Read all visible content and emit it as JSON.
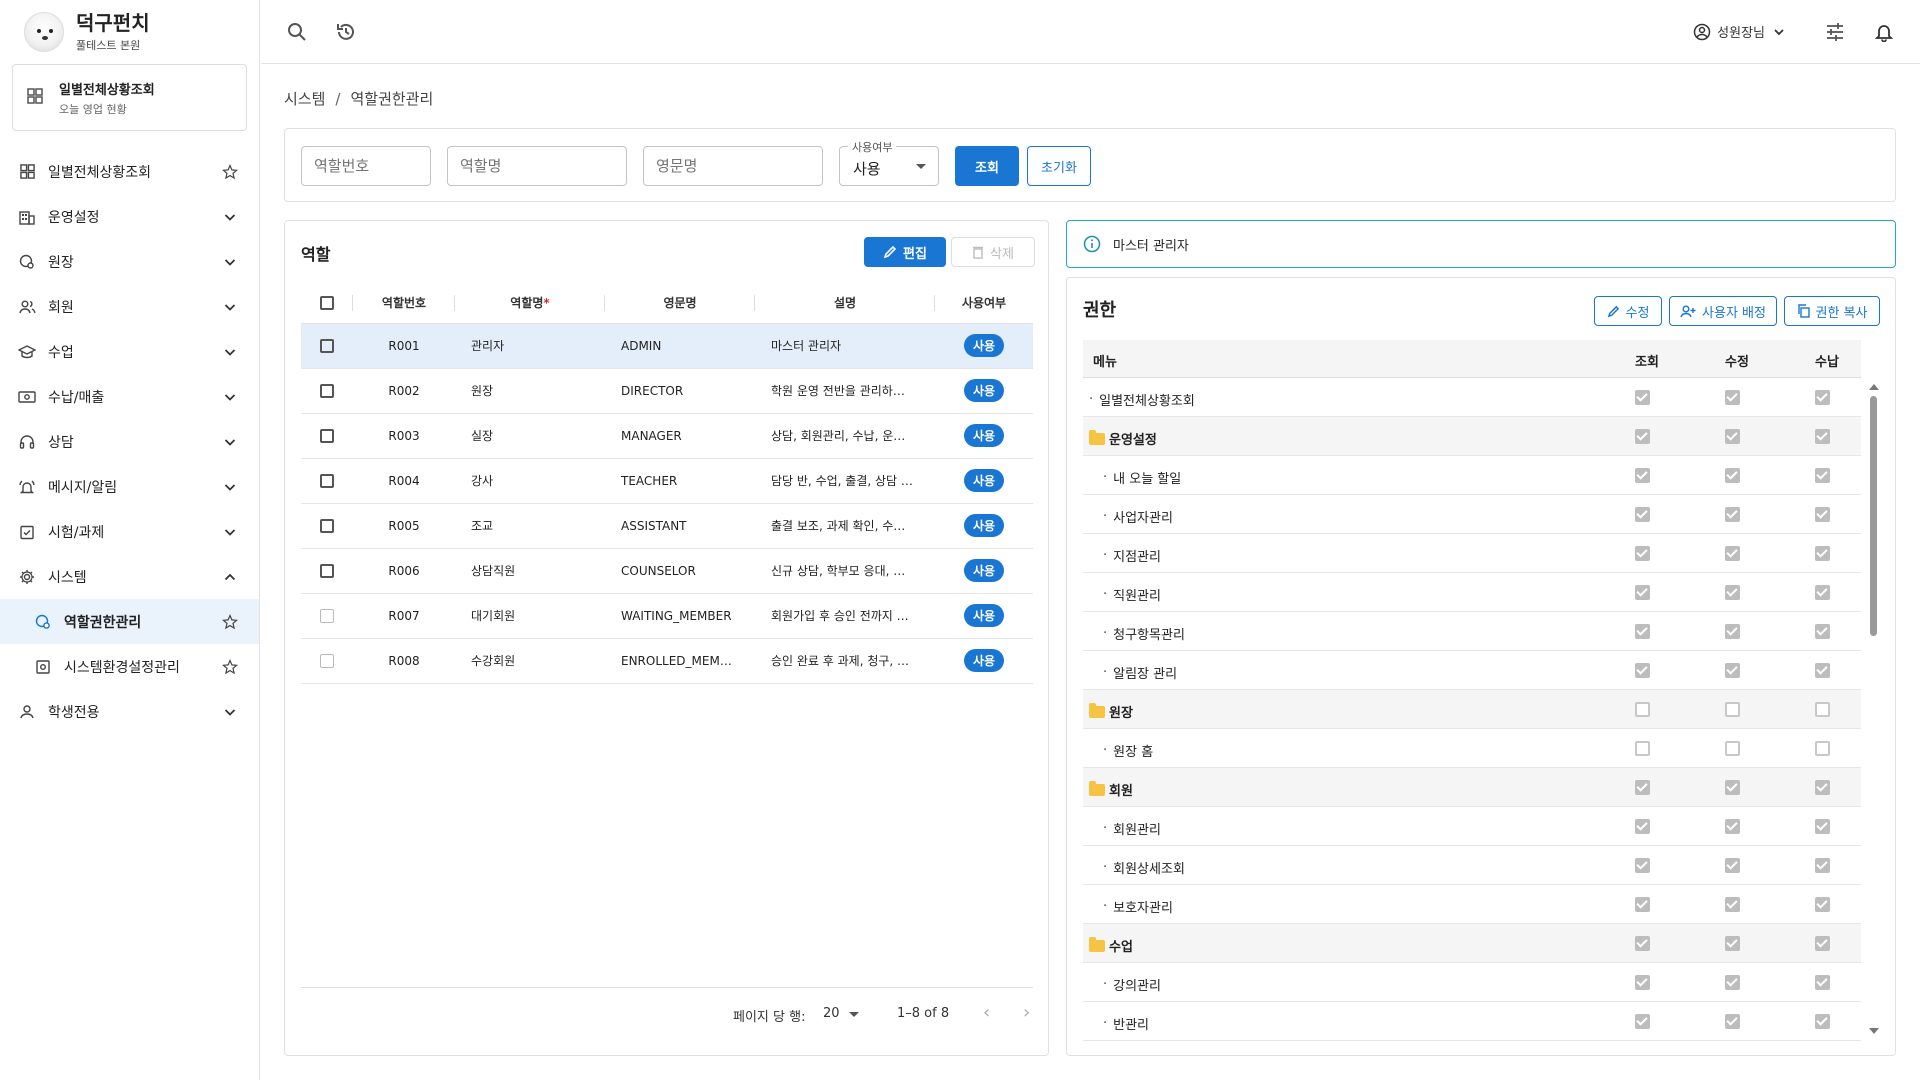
{
  "brand": {
    "title": "덕구펀치",
    "subtitle": "풀테스트 본원"
  },
  "quick_card": {
    "title": "일별전체상황조회",
    "subtitle": "오늘 영업 현황"
  },
  "sidebar": {
    "items": [
      {
        "label": "일별전체상황조회",
        "icon": "dashboard-icon",
        "right": "star-icon"
      },
      {
        "label": "운영설정",
        "icon": "building-icon",
        "right": "chevron-down-icon"
      },
      {
        "label": "원장",
        "icon": "person-gear-icon",
        "right": "chevron-down-icon"
      },
      {
        "label": "회원",
        "icon": "users-icon",
        "right": "chevron-down-icon"
      },
      {
        "label": "수업",
        "icon": "school-icon",
        "right": "chevron-down-icon"
      },
      {
        "label": "수납/매출",
        "icon": "payment-icon",
        "right": "chevron-down-icon"
      },
      {
        "label": "상담",
        "icon": "headset-icon",
        "right": "chevron-down-icon"
      },
      {
        "label": "메시지/알림",
        "icon": "bell-ring-icon",
        "right": "chevron-down-icon"
      },
      {
        "label": "시험/과제",
        "icon": "assignment-icon",
        "right": "chevron-down-icon"
      },
      {
        "label": "시스템",
        "icon": "gear-icon",
        "right": "chevron-up-icon"
      },
      {
        "label": "역할권한관리",
        "icon": "role-icon",
        "right": "star-icon",
        "sub": true,
        "active": true
      },
      {
        "label": "시스템환경설정관리",
        "icon": "settings-box-icon",
        "right": "star-icon",
        "sub": true
      },
      {
        "label": "학생전용",
        "icon": "person-icon",
        "right": "chevron-down-icon"
      }
    ]
  },
  "header": {
    "user": "성원장님"
  },
  "breadcrumb": {
    "root": "시스템",
    "sep": "/",
    "current": "역할권한관리"
  },
  "filter": {
    "role_no_placeholder": "역할번호",
    "role_name_placeholder": "역할명",
    "eng_name_placeholder": "영문명",
    "use_legend": "사용여부",
    "use_value": "사용",
    "search_label": "조회",
    "reset_label": "초기화"
  },
  "roles": {
    "title": "역할",
    "edit_label": "편집",
    "delete_label": "삭제",
    "columns": {
      "no": "역할번호",
      "name": "역할명",
      "name_req": "*",
      "eng": "영문명",
      "desc": "설명",
      "use": "사용여부"
    },
    "rows": [
      {
        "no": "R001",
        "name": "관리자",
        "eng": "ADMIN",
        "desc": "마스터 관리자",
        "use": "사용"
      },
      {
        "no": "R002",
        "name": "원장",
        "eng": "DIRECTOR",
        "desc": "학원 운영 전반을 관리하…",
        "use": "사용"
      },
      {
        "no": "R003",
        "name": "실장",
        "eng": "MANAGER",
        "desc": "상담, 회원관리, 수납, 운…",
        "use": "사용"
      },
      {
        "no": "R004",
        "name": "강사",
        "eng": "TEACHER",
        "desc": "담당 반, 수업, 출결, 상담 …",
        "use": "사용"
      },
      {
        "no": "R005",
        "name": "조교",
        "eng": "ASSISTANT",
        "desc": "출결 보조, 과제 확인, 수…",
        "use": "사용"
      },
      {
        "no": "R006",
        "name": "상담직원",
        "eng": "COUNSELOR",
        "desc": "신규 상담, 학부모 응대, …",
        "use": "사용"
      },
      {
        "no": "R007",
        "name": "대기회원",
        "eng": "WAITING_MEMBER",
        "desc": "회원가입 후 승인 전까지 …",
        "use": "사용"
      },
      {
        "no": "R008",
        "name": "수강회원",
        "eng": "ENROLLED_MEM…",
        "desc": "승인 완료 후 과제, 청구, …",
        "use": "사용"
      }
    ],
    "pager": {
      "rows_per_page_label": "페이지 당 행:",
      "rows_per_page": "20",
      "range": "1–8 of 8"
    }
  },
  "info": {
    "text": "마스터 관리자"
  },
  "perm": {
    "title": "권한",
    "edit_label": "수정",
    "assign_label": "사용자 배정",
    "copy_label": "권한 복사",
    "columns": {
      "menu": "메뉴",
      "view": "조회",
      "edit": "수정",
      "pay": "수납"
    },
    "rows": [
      {
        "name": "일별전체상황조회",
        "type": "top",
        "view": true,
        "edit": true,
        "pay": true
      },
      {
        "name": "운영설정",
        "type": "folder",
        "view": true,
        "edit": true,
        "pay": true
      },
      {
        "name": "내 오늘 할일",
        "type": "child",
        "view": true,
        "edit": true,
        "pay": true
      },
      {
        "name": "사업자관리",
        "type": "child",
        "view": true,
        "edit": true,
        "pay": true
      },
      {
        "name": "지점관리",
        "type": "child",
        "view": true,
        "edit": true,
        "pay": true
      },
      {
        "name": "직원관리",
        "type": "child",
        "view": true,
        "edit": true,
        "pay": true
      },
      {
        "name": "청구항목관리",
        "type": "child",
        "view": true,
        "edit": true,
        "pay": true
      },
      {
        "name": "알림장 관리",
        "type": "child",
        "view": true,
        "edit": true,
        "pay": true
      },
      {
        "name": "원장",
        "type": "folder",
        "view": false,
        "edit": false,
        "pay": false
      },
      {
        "name": "원장 홈",
        "type": "child",
        "view": false,
        "edit": false,
        "pay": false
      },
      {
        "name": "회원",
        "type": "folder",
        "view": true,
        "edit": true,
        "pay": true
      },
      {
        "name": "회원관리",
        "type": "child",
        "view": true,
        "edit": true,
        "pay": true
      },
      {
        "name": "회원상세조회",
        "type": "child",
        "view": true,
        "edit": true,
        "pay": true
      },
      {
        "name": "보호자관리",
        "type": "child",
        "view": true,
        "edit": true,
        "pay": true
      },
      {
        "name": "수업",
        "type": "folder",
        "view": true,
        "edit": true,
        "pay": true
      },
      {
        "name": "강의관리",
        "type": "child",
        "view": true,
        "edit": true,
        "pay": true
      },
      {
        "name": "반관리",
        "type": "child",
        "view": true,
        "edit": true,
        "pay": true
      }
    ]
  },
  "colors": {
    "accent": "#1976d2",
    "active_bg": "#eaf2fb",
    "info_border": "#26a6c9",
    "folder": "#f6c342"
  }
}
